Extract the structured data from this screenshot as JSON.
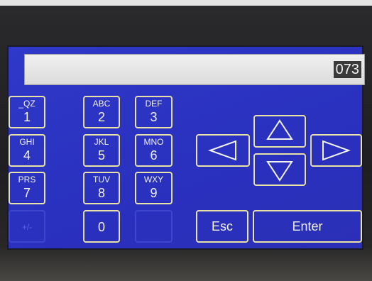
{
  "display": {
    "value": "073"
  },
  "keypad": {
    "keys": [
      {
        "letters": "_QZ",
        "digit": "1"
      },
      {
        "letters": "ABC",
        "digit": "2"
      },
      {
        "letters": "DEF",
        "digit": "3"
      },
      {
        "letters": "GHI",
        "digit": "4"
      },
      {
        "letters": "JKL",
        "digit": "5"
      },
      {
        "letters": "MNO",
        "digit": "6"
      },
      {
        "letters": "PRS",
        "digit": "7"
      },
      {
        "letters": "TUV",
        "digit": "8"
      },
      {
        "letters": "WXY",
        "digit": "9"
      },
      {
        "letters": "+/-",
        "digit": ""
      },
      {
        "letters": "",
        "digit": "0"
      }
    ]
  },
  "buttons": {
    "esc_label": "Esc",
    "enter_label": "Enter"
  },
  "icons": {
    "left": "arrow-left-icon",
    "up": "arrow-up-icon",
    "down": "arrow-down-icon",
    "right": "arrow-right-icon"
  },
  "colors": {
    "screen": "#2f38c8",
    "key_border": "#e8e2a8",
    "display_bg": "#e6e6e6"
  }
}
